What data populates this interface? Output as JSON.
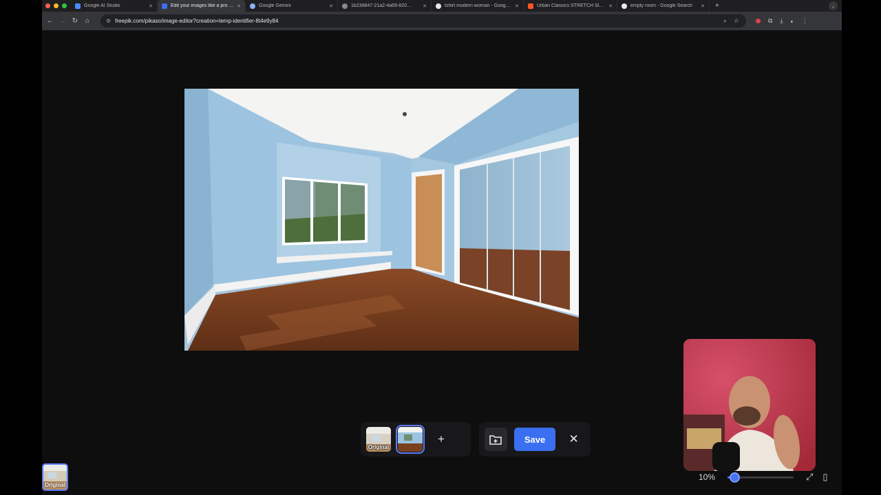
{
  "browser": {
    "tabs": [
      {
        "label": "Google AI Studio",
        "active": false,
        "fav": "#4a8cff"
      },
      {
        "label": "Edit your images like a pro w…",
        "active": true,
        "fav": "#3f6df1"
      },
      {
        "label": "Google Gemini",
        "active": false,
        "fav": "#8ab4f8"
      },
      {
        "label": "1b238847-21a2-4a69-820…",
        "active": false,
        "fav": "#888"
      },
      {
        "label": "tshirt modern woman - Goog…",
        "active": false,
        "fav": "#e8eaed"
      },
      {
        "label": "Urban Classics STRETCH Sl…",
        "active": false,
        "fav": "#ff5722"
      },
      {
        "label": "empty room - Google Search",
        "active": false,
        "fav": "#e8eaed"
      }
    ],
    "new_tab": "+",
    "url": "freepik.com/pikaso/image-editor?creation=temp-identifier-8t4e9y84"
  },
  "editor": {
    "thumbnails": [
      {
        "label": "Original",
        "selected": false
      },
      {
        "label": "",
        "selected": true
      }
    ],
    "add_label": "+",
    "save_label": "Save",
    "close_label": "✕",
    "history_label": "Original"
  },
  "zoom": {
    "value_label": "10%",
    "value": 0.1
  },
  "colors": {
    "accent": "#3a6ff0",
    "wall": "#9cc2df",
    "floor": "#7a4020"
  }
}
